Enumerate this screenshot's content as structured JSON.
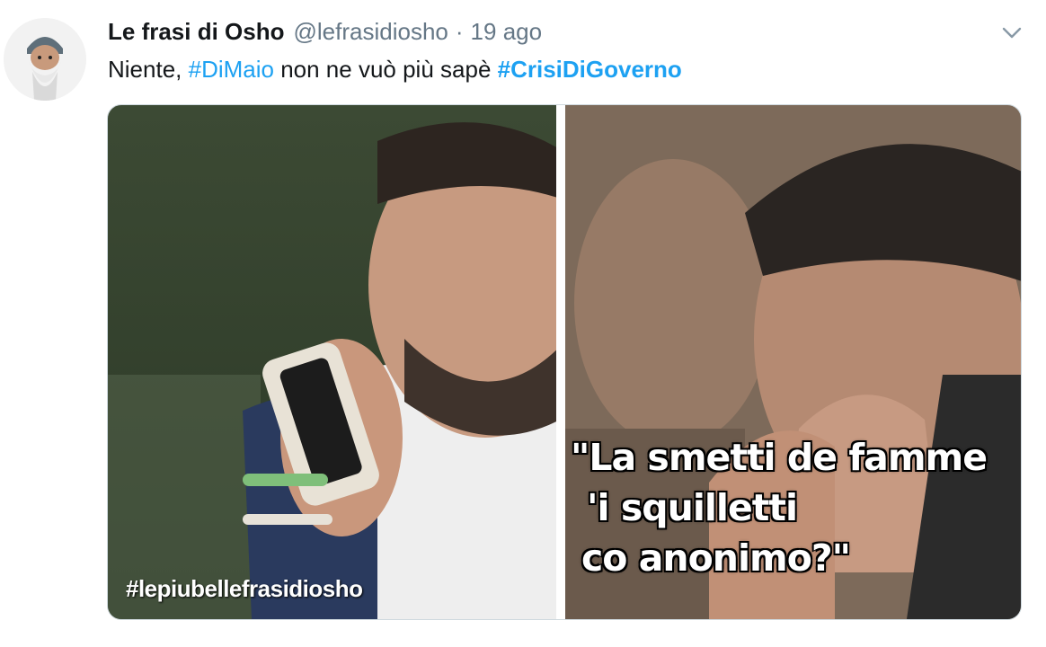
{
  "tweet": {
    "author_name": "Le frasi di Osho",
    "handle": "@lefrasidiosho",
    "separator": "·",
    "time": "19 ago",
    "text_prefix": "Niente, ",
    "hashtag1": "#DiMaio",
    "text_middle": " non ne vuò più sapè ",
    "hashtag2": "#CrisiDiGoverno"
  },
  "media": {
    "watermark": "#lepiubellefrasidiosho",
    "quote_line1": "\"La smetti de famme",
    "quote_line2": "'i squilletti",
    "quote_line3": "co anonimo?\""
  },
  "colors": {
    "link": "#1da1f2",
    "secondary": "#657786",
    "text": "#14171a"
  },
  "icons": {
    "caret": "chevron-down-icon"
  }
}
